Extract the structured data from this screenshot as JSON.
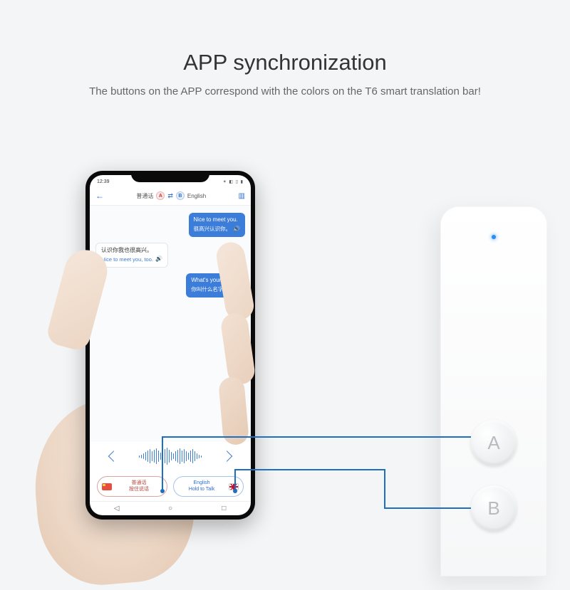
{
  "heading": {
    "title": "APP synchronization",
    "subtitle": "The buttons on the APP correspond with the colors on the T6 smart translation bar!"
  },
  "phone": {
    "status": {
      "time": "12:39",
      "icons_left": "⬚ ✉ ⬚ ⬚",
      "icons_right": "✶ ◧ ▯ ▮"
    },
    "appbar": {
      "back": "←",
      "langA": "普通话",
      "chipA": "A",
      "swap": "⇄",
      "chipB": "B",
      "langB": "English",
      "book": "▥"
    },
    "chat": [
      {
        "side": "right",
        "l1": "Nice to meet you.",
        "l2": "很高兴认识你。"
      },
      {
        "side": "left",
        "l1": "认识你我也很高兴。",
        "l2": "Nice to meet you, too."
      },
      {
        "side": "right",
        "l1": "What's your name?",
        "l2": "你叫什么名字？"
      }
    ],
    "buttons": {
      "a": {
        "lang": "普通话",
        "hold": "按住说话"
      },
      "b": {
        "lang": "English",
        "hold": "Hold to Talk"
      }
    },
    "nav": {
      "back": "◁",
      "home": "○",
      "recent": "□"
    }
  },
  "device": {
    "btnA": "A",
    "btnB": "B"
  }
}
